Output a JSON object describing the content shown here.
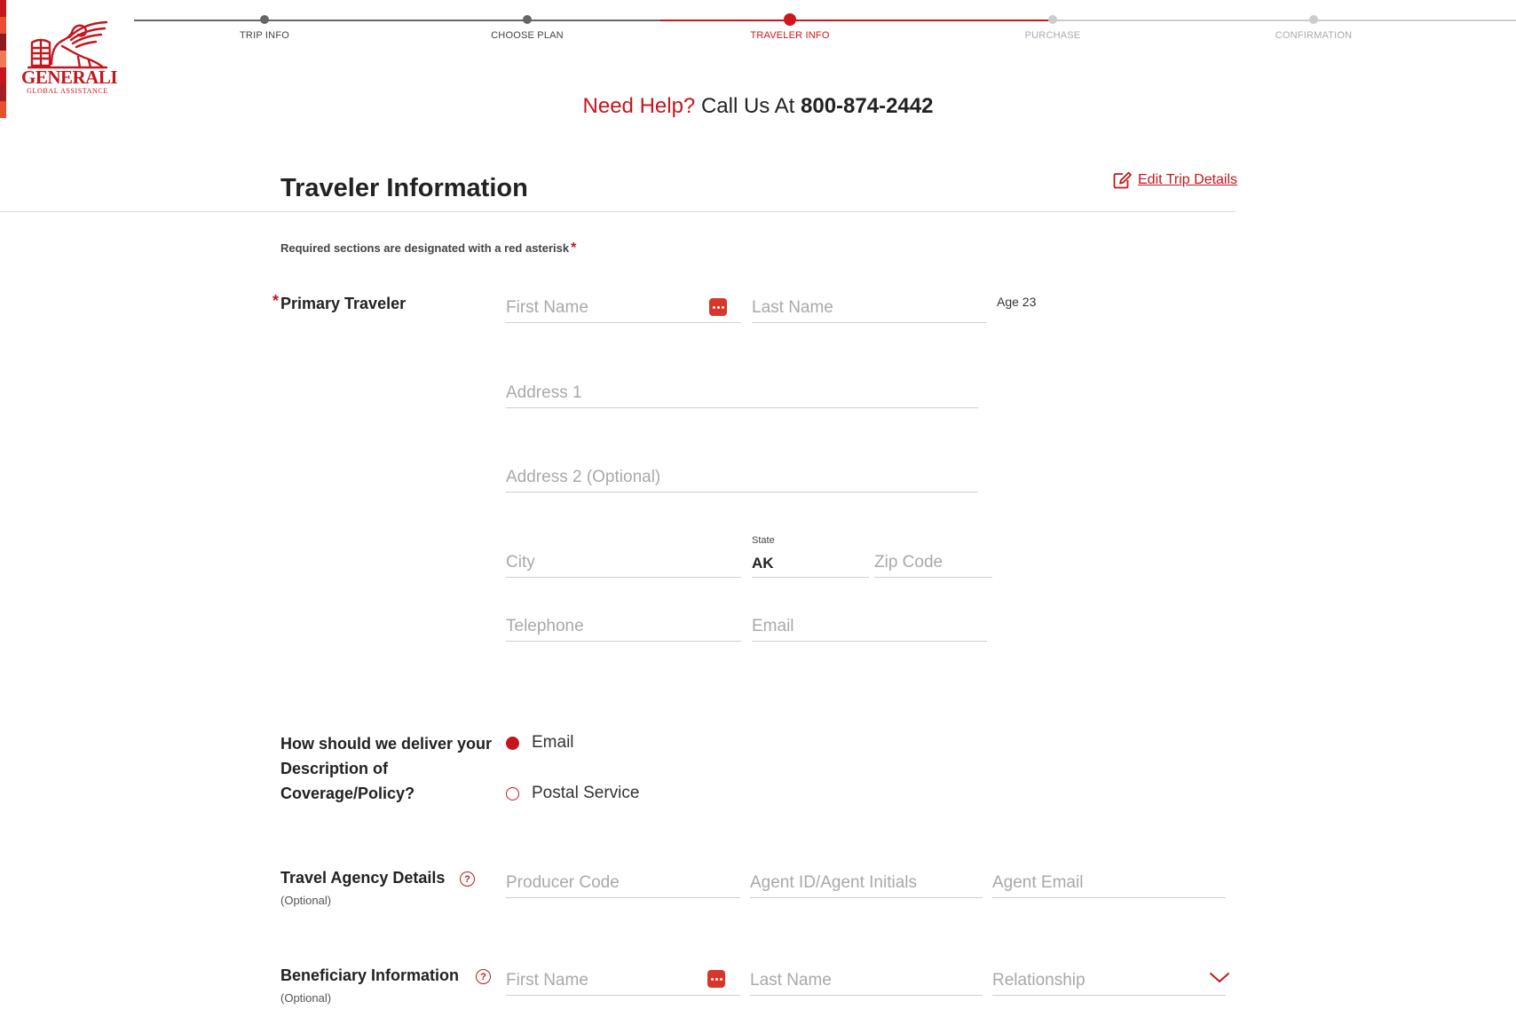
{
  "brand": {
    "name": "GENERALI",
    "subtitle": "GLOBAL ASSISTANCE",
    "color": "#c4161c",
    "strip_colors": [
      "#c4161c",
      "#e8502e",
      "#8e1b1d",
      "#f07a52",
      "#c4161c",
      "#a31f22",
      "#e8502e"
    ]
  },
  "progress": {
    "active_color": "#d0161c",
    "done_color": "#666666",
    "todo_color": "#cccccc",
    "steps": [
      {
        "label": "TRIP INFO",
        "state": "done"
      },
      {
        "label": "CHOOSE PLAN",
        "state": "done"
      },
      {
        "label": "TRAVELER INFO",
        "state": "active"
      },
      {
        "label": "PURCHASE",
        "state": "todo"
      },
      {
        "label": "CONFIRMATION",
        "state": "todo"
      }
    ]
  },
  "help": {
    "question": "Need Help?",
    "text": "Call Us At",
    "phone": "800-874-2442"
  },
  "header": {
    "title": "Traveler Information",
    "edit_link": "Edit Trip Details",
    "edit_icon": "edit-icon"
  },
  "required_note": {
    "text": "Required sections are designated with a red asterisk",
    "asterisk": "*"
  },
  "primary_traveler": {
    "label": "Primary Traveler",
    "asterisk": "*",
    "first_name_placeholder": "First Name",
    "last_name_placeholder": "Last Name",
    "age": "Age 23",
    "address1_placeholder": "Address 1",
    "address2_placeholder": "Address 2 (Optional)",
    "city_placeholder": "City",
    "state_label": "State",
    "state_value": "AK",
    "zip_placeholder": "Zip Code",
    "telephone_placeholder": "Telephone",
    "email_placeholder": "Email"
  },
  "delivery": {
    "label_line1": "How should we deliver your",
    "label_line2": "Description of",
    "label_line3": "Coverage/Policy?",
    "options": [
      {
        "label": "Email",
        "selected": true
      },
      {
        "label": "Postal Service",
        "selected": false
      }
    ]
  },
  "travel_agency": {
    "label": "Travel Agency Details",
    "optional": "(Optional)",
    "help_glyph": "?",
    "producer_code_placeholder": "Producer Code",
    "agent_id_placeholder": "Agent ID/Agent Initials",
    "agent_email_placeholder": "Agent Email"
  },
  "beneficiary": {
    "label": "Beneficiary Information",
    "optional": "(Optional)",
    "help_glyph": "?",
    "first_name_placeholder": "First Name",
    "last_name_placeholder": "Last Name",
    "relationship_placeholder": "Relationship"
  }
}
